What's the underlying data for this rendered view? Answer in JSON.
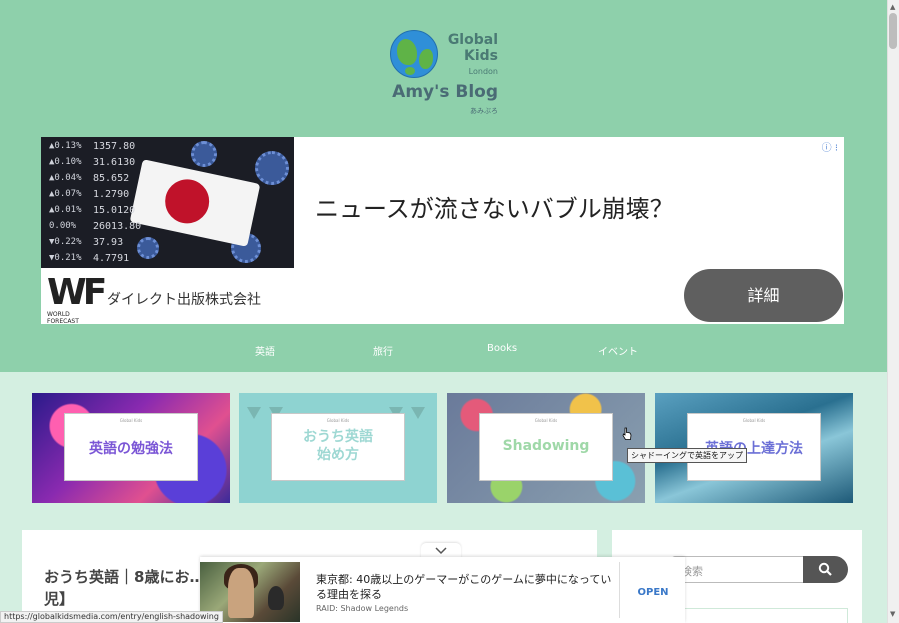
{
  "logo": {
    "line1": "Global",
    "line2": "Kids",
    "line3": "London",
    "line4": "Amy's Blog",
    "line5": "あみぶろ"
  },
  "top_ad": {
    "badge": "ⓘ ⁝",
    "ticker_rows": [
      {
        "change": "▲0.13%",
        "value": "1357.80"
      },
      {
        "change": "▲0.10%",
        "value": "31.6130"
      },
      {
        "change": "▲0.04%",
        "value": "85.652"
      },
      {
        "change": "▲0.07%",
        "value": "1.2790"
      },
      {
        "change": "▲0.01%",
        "value": "15.0120"
      },
      {
        "change": "0.00%",
        "value": "26013.80"
      },
      {
        "change": "▼0.22%",
        "value": "37.93"
      },
      {
        "change": "▼0.21%",
        "value": "4.7791"
      }
    ],
    "headline": "ニュースが流さないバブル崩壊？",
    "advertiser_logo": "WF",
    "advertiser_logo_sub": "WORLD FORECAST",
    "advertiser": "ダイレクト出版株式会社",
    "cta": "詳細"
  },
  "nav": {
    "items": [
      "英語",
      "旅行",
      "Books",
      "イベント"
    ]
  },
  "tiles": [
    {
      "small": "Global Kids",
      "title": "英語の勉強法",
      "color": "#7b56d6"
    },
    {
      "small": "Global Kids",
      "title": "おうち英語\n始め方",
      "color": "#9ed8d3"
    },
    {
      "small": "Global Kids",
      "title": "Shadowing",
      "color": "#9fd8a8"
    },
    {
      "small": "Global Kids",
      "title": "英語の上達方法",
      "color": "#6b6fd6"
    }
  ],
  "tooltip": "シャドーイングで英語をアップ",
  "post": {
    "title": "おうち英語｜8歳にお…\n児】"
  },
  "sidebar": {
    "search_placeholder": "検索"
  },
  "bottom_ad": {
    "headline": "東京都: 40歳以上のゲーマーがこのゲームに夢中になっている理由を探る",
    "source": "RAID: Shadow Legends",
    "open_label": "OPEN"
  },
  "status_url": "https://globalkidsmedia.com/entry/english-shadowing",
  "colors": {
    "header_bg": "#8ed0ab",
    "page_bg": "#d4efe1",
    "cta_bg": "#5f5f5f"
  },
  "icons": {
    "search": "search-icon",
    "collapse": "chevron-down-icon",
    "adchoices": "adchoices-icon"
  }
}
